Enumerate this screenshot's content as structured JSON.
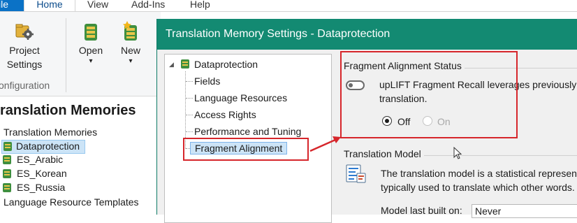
{
  "ribbon": {
    "tabs": {
      "file": "ile",
      "home": "Home",
      "view": "View",
      "addins": "Add-Ins",
      "help": "Help"
    },
    "project_settings_line1": "Project",
    "project_settings_line2": "Settings",
    "group_label": "onfiguration",
    "open_label": "Open",
    "new_label": "New",
    "dropdown_glyph": "▾"
  },
  "left_pane": {
    "title": "ranslation Memories",
    "root_label": "Translation Memories",
    "items": [
      "Dataprotection",
      "ES_Arabic",
      "ES_Korean",
      "ES_Russia"
    ],
    "templates_label": "Language Resource Templates"
  },
  "dialog": {
    "title": "Translation Memory Settings - Dataprotection",
    "tree": {
      "root": "Dataprotection",
      "expander": "◢",
      "children": [
        "Fields",
        "Language Resources",
        "Access Rights",
        "Performance and Tuning",
        "Fragment Alignment"
      ]
    },
    "fragment_status": {
      "heading": "Fragment Alignment Status",
      "description_line1": "upLIFT Fragment Recall leverages previously tr",
      "description_line2": "translation.",
      "off_label": "Off",
      "on_label": "On",
      "selected": "Off"
    },
    "translation_model": {
      "heading": "Translation Model",
      "description_line1": "The translation model is a statistical representat",
      "description_line2": "typically used to translate which other words.",
      "last_built_label": "Model last built on:",
      "last_built_value": "Never"
    }
  },
  "colors": {
    "accent_blue": "#0b72c6",
    "dialog_title_bg": "#138a72",
    "selection_bg": "#cce4f7",
    "annotation_red": "#d6262b"
  },
  "icons": [
    "tm-database-icon",
    "settings-gear-icon",
    "star-icon",
    "translation-model-icon",
    "mouse-pointer-icon",
    "annotation-arrow-icon"
  ]
}
